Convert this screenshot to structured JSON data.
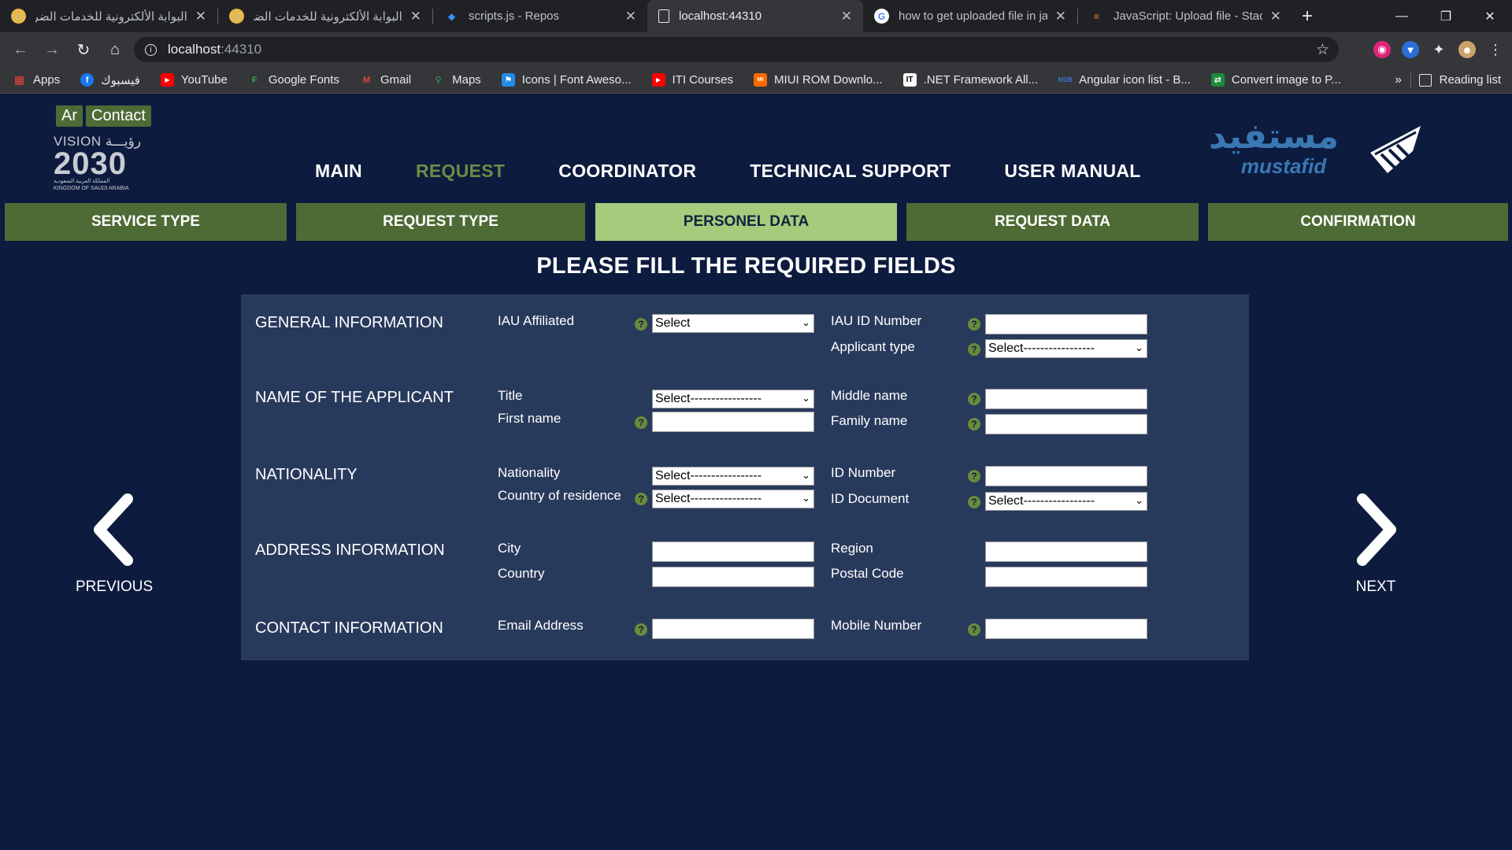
{
  "browser": {
    "tabs": [
      {
        "label": "البوابة الألكترونية للخدمات الضر",
        "icon": "emoji-face-icon",
        "active": false
      },
      {
        "label": "البوابة الألكترونية للخدمات الضر",
        "icon": "emoji-face-icon",
        "active": false
      },
      {
        "label": "scripts.js - Repos",
        "icon": "vscode-icon",
        "active": false
      },
      {
        "label": "localhost:44310",
        "icon": "page-icon",
        "active": true
      },
      {
        "label": "how to get uploaded file in ja",
        "icon": "google-icon",
        "active": false
      },
      {
        "label": "JavaScript: Upload file - Stack",
        "icon": "stackoverflow-icon",
        "active": false
      }
    ],
    "address": {
      "host": "localhost",
      "port": ":44310"
    },
    "bookmarks": [
      {
        "label": "Apps",
        "icon": "apps-grid-icon",
        "color": "#ea4335"
      },
      {
        "label": "فيسبوك",
        "icon": "facebook-icon",
        "color": "#1877f2"
      },
      {
        "label": "YouTube",
        "icon": "youtube-icon",
        "color": "#ff0000"
      },
      {
        "label": "Google Fonts",
        "icon": "google-fonts-icon",
        "color": "#34a853"
      },
      {
        "label": "Gmail",
        "icon": "gmail-icon",
        "color": "#ea4335"
      },
      {
        "label": "Maps",
        "icon": "maps-icon",
        "color": "#34a853"
      },
      {
        "label": "Icons | Font Aweso...",
        "icon": "font-awesome-icon",
        "color": "#228ae6"
      },
      {
        "label": "ITI Courses",
        "icon": "youtube-icon",
        "color": "#ff0000"
      },
      {
        "label": "MIUI ROM Downlo...",
        "icon": "miui-icon",
        "color": "#ff6a00"
      },
      {
        "label": ".NET Framework All...",
        "icon": "dotnet-icon",
        "color": "#ffffff"
      },
      {
        "label": "Angular icon list - B...",
        "icon": "mdb-icon",
        "color": "#3b71ca"
      },
      {
        "label": "Convert image to P...",
        "icon": "convert-icon",
        "color": "#1d8a3c"
      }
    ],
    "reading_list": "Reading list"
  },
  "header": {
    "lang_button": "Ar",
    "contact_button": "Contact",
    "vision_top": "VISION رؤيـــة",
    "vision_year": "2030",
    "vision_sub_ar": "المملكة العربية السعودية",
    "vision_sub_en": "KINGDOM OF SAUDI ARABIA",
    "nav": [
      {
        "label": "MAIN",
        "current": false
      },
      {
        "label": "REQUEST",
        "current": true
      },
      {
        "label": "COORDINATOR",
        "current": false
      },
      {
        "label": "TECHNICAL SUPPORT",
        "current": false
      },
      {
        "label": "USER MANUAL",
        "current": false
      }
    ],
    "brand_ar": "مستفيد",
    "brand_en": "mustafid",
    "accent_color": "#6f8a46"
  },
  "steps": [
    {
      "label": "SERVICE TYPE",
      "active": false
    },
    {
      "label": "REQUEST TYPE",
      "active": false
    },
    {
      "label": "PERSONEL DATA",
      "active": true
    },
    {
      "label": "REQUEST DATA",
      "active": false
    },
    {
      "label": "CONFIRMATION",
      "active": false
    }
  ],
  "form": {
    "heading": "PLEASE FILL THE REQUIRED FIELDS",
    "sections": {
      "general": "GENERAL INFORMATION",
      "name": "NAME OF THE APPLICANT",
      "nationality": "NATIONALITY",
      "address": "ADDRESS INFORMATION",
      "contact": "CONTACT INFORMATION"
    },
    "labels": {
      "iau_affiliated": "IAU Affiliated",
      "iau_id": "IAU ID Number",
      "applicant_type": "Applicant type",
      "title": "Title",
      "first_name": "First name",
      "middle_name": "Middle name",
      "family_name": "Family name",
      "nationality": "Nationality",
      "country_residence": "Country of residence",
      "id_number": "ID Number",
      "id_document": "ID Document",
      "city": "City",
      "country": "Country",
      "region": "Region",
      "postal_code": "Postal Code",
      "email": "Email Address",
      "mobile": "Mobile Number"
    },
    "selects": {
      "iau_affiliated": "Select",
      "applicant_type": "Select-----------------",
      "title": "Select-----------------",
      "nationality": "Select-----------------",
      "country_residence": "Select-----------------",
      "id_document": "Select-----------------"
    },
    "help_glyph": "?"
  },
  "pager": {
    "previous": "PREVIOUS",
    "next": "NEXT"
  }
}
